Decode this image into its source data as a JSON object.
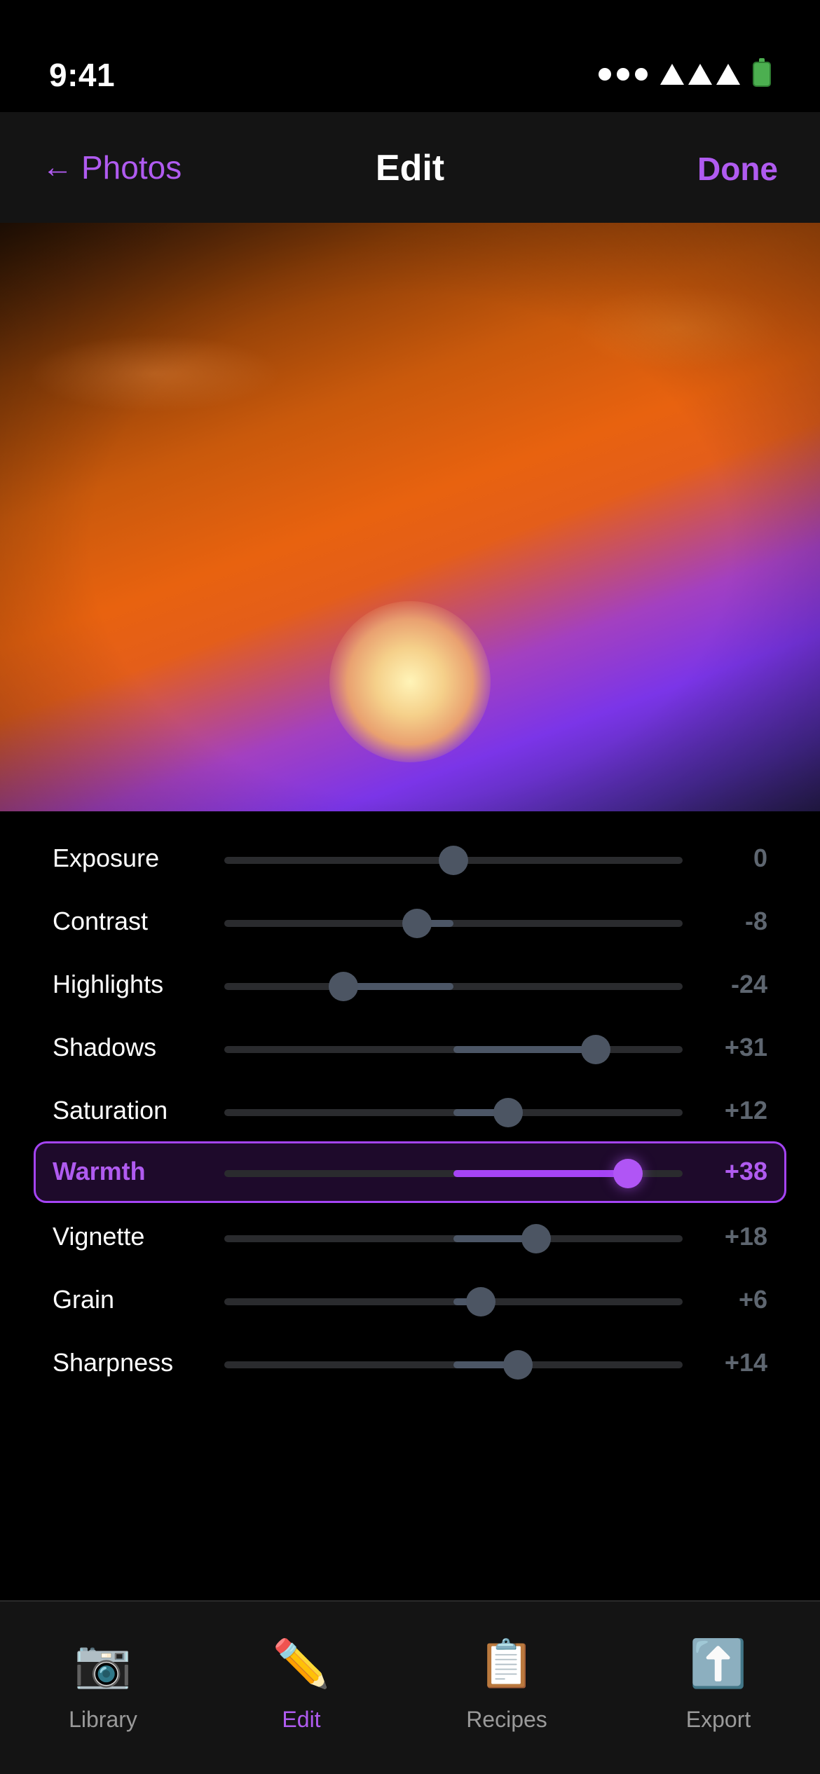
{
  "status_bar": {
    "time": "9:41",
    "battery_color": "#4caf50"
  },
  "nav": {
    "back_label": "Photos",
    "back_arrow": "←",
    "title": "Edit",
    "done_label": "Done",
    "accent_color": "#b05bf0"
  },
  "photo": {
    "description_colors": [
      "#e8620f",
      "#7b35e8",
      "#f5d08a"
    ]
  },
  "adjustments": {
    "min": -50,
    "max": 50,
    "active": "Warmth",
    "items": [
      {
        "label": "Exposure",
        "value": "0",
        "amount": 0
      },
      {
        "label": "Contrast",
        "value": "-8",
        "amount": -8
      },
      {
        "label": "Highlights",
        "value": "-24",
        "amount": -24
      },
      {
        "label": "Shadows",
        "value": "+31",
        "amount": 31
      },
      {
        "label": "Saturation",
        "value": "+12",
        "amount": 12
      },
      {
        "label": "Warmth",
        "value": "+38",
        "amount": 38
      },
      {
        "label": "Vignette",
        "value": "+18",
        "amount": 18
      },
      {
        "label": "Grain",
        "value": "+6",
        "amount": 6
      },
      {
        "label": "Sharpness",
        "value": "+14",
        "amount": 14
      }
    ]
  },
  "tab_bar": {
    "active": "Edit",
    "tabs": [
      {
        "label": "Library",
        "icon": "📷",
        "icon_name": "camera-icon"
      },
      {
        "label": "Edit",
        "icon": "✏️",
        "icon_name": "pencil-icon"
      },
      {
        "label": "Recipes",
        "icon": "📋",
        "icon_name": "clipboard-icon"
      },
      {
        "label": "Export",
        "icon": "⬆️",
        "icon_name": "upload-icon"
      }
    ]
  }
}
